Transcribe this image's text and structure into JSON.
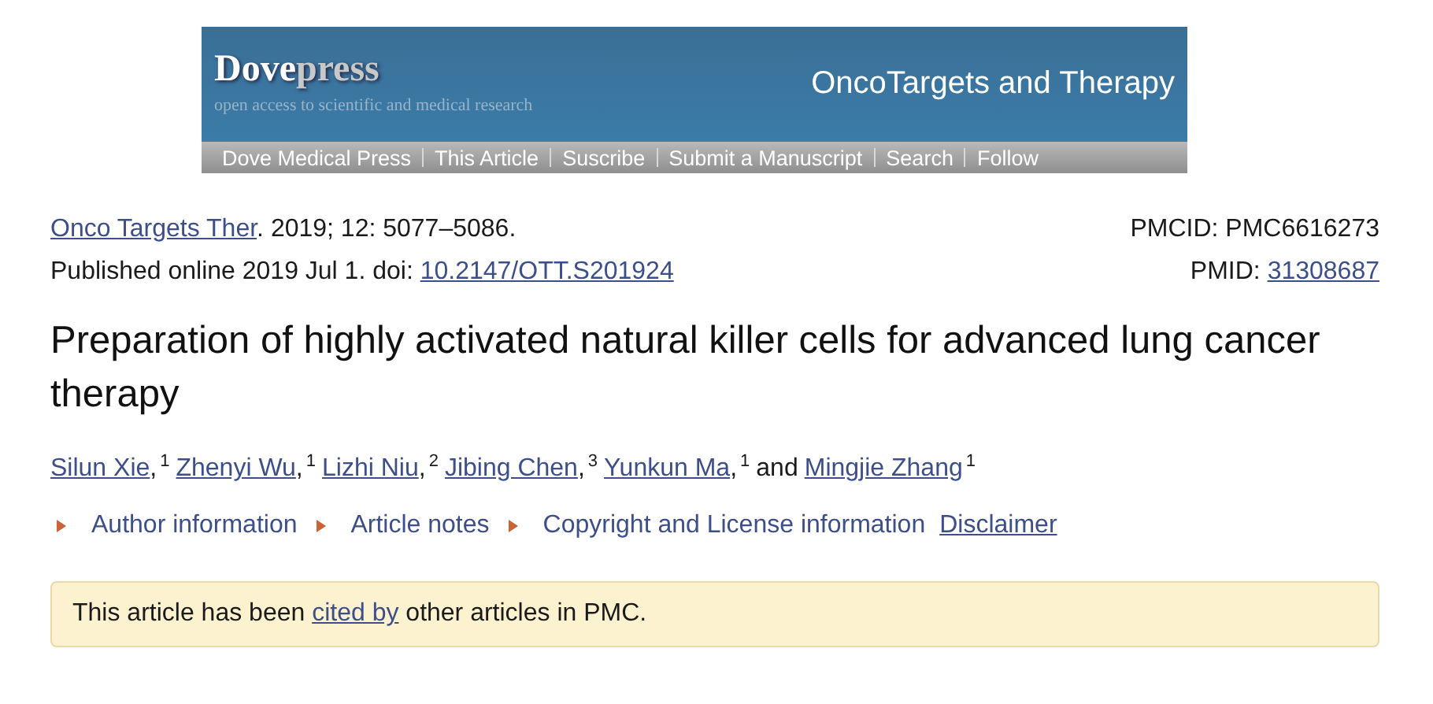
{
  "banner": {
    "logo": [
      "Dove",
      "press"
    ],
    "tagline": "open access to scientific and medical research",
    "journal": "OncoTargets and Therapy",
    "nav": [
      "Dove Medical Press",
      "This Article",
      "Suscribe",
      "Submit a Manuscript",
      "Search",
      "Follow"
    ]
  },
  "citation": {
    "journal": "Onco Targets Ther",
    "rest": ". 2019; 12: 5077–5086.",
    "pmcid": "PMCID: PMC6616273"
  },
  "published": {
    "text": "Published online 2019 Jul 1. doi: ",
    "doi": "10.2147/OTT.S201924",
    "pmid_label": "PMID: ",
    "pmid": "31308687"
  },
  "title": "Preparation of highly activated natural killer cells for advanced lung cancer therapy",
  "authors": [
    {
      "kind": "author",
      "name": "Silun Xie",
      "sep": ",",
      "sup": "1"
    },
    {
      "kind": "author",
      "name": "Zhenyi Wu",
      "sep": ",",
      "sup": "1"
    },
    {
      "kind": "author",
      "name": "Lizhi Niu",
      "sep": ",",
      "sup": "2"
    },
    {
      "kind": "author",
      "name": "Jibing Chen",
      "sep": ",",
      "sup": "3"
    },
    {
      "kind": "author",
      "name": "Yunkun Ma",
      "sep": ",",
      "sup": "1"
    },
    {
      "kind": "text",
      "name": "and"
    },
    {
      "kind": "author",
      "name": "Mingjie Zhang",
      "sup": "1"
    }
  ],
  "info_links": [
    {
      "kind": "toggle",
      "label": "Author information"
    },
    {
      "kind": "toggle",
      "label": "Article notes"
    },
    {
      "kind": "toggle",
      "label": "Copyright and License information"
    },
    {
      "kind": "link",
      "label": "Disclaimer"
    }
  ],
  "notice": {
    "before": "This article has been ",
    "link": "cited by",
    "after": " other articles in PMC."
  }
}
